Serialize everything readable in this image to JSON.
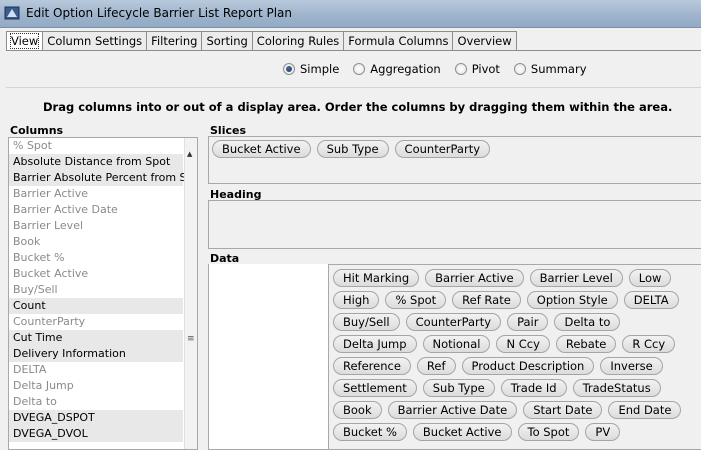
{
  "window": {
    "title": "Edit Option Lifecycle Barrier List Report Plan"
  },
  "tabs": [
    {
      "label": "View",
      "active": true
    },
    {
      "label": "Column Settings",
      "active": false
    },
    {
      "label": "Filtering",
      "active": false
    },
    {
      "label": "Sorting",
      "active": false
    },
    {
      "label": "Coloring Rules",
      "active": false
    },
    {
      "label": "Formula Columns",
      "active": false
    },
    {
      "label": "Overview",
      "active": false
    }
  ],
  "modes": [
    {
      "label": "Simple",
      "selected": true
    },
    {
      "label": "Aggregation",
      "selected": false
    },
    {
      "label": "Pivot",
      "selected": false
    },
    {
      "label": "Summary",
      "selected": false
    }
  ],
  "instructions": "Drag columns into or out of a display area. Order the columns by dragging them within the area.",
  "columns": {
    "header": "Columns",
    "items": [
      {
        "label": "% Spot",
        "style": "grey"
      },
      {
        "label": "Absolute Distance from Spot",
        "style": "shade"
      },
      {
        "label": "Barrier Absolute Percent from Spot",
        "style": "shade"
      },
      {
        "label": "Barrier Active",
        "style": "grey"
      },
      {
        "label": "Barrier Active Date",
        "style": "grey"
      },
      {
        "label": "Barrier Level",
        "style": "grey"
      },
      {
        "label": "Book",
        "style": "grey"
      },
      {
        "label": "Bucket %",
        "style": "grey"
      },
      {
        "label": "Bucket Active",
        "style": "grey"
      },
      {
        "label": "Buy/Sell",
        "style": "grey"
      },
      {
        "label": "Count",
        "style": "shade"
      },
      {
        "label": "CounterParty",
        "style": "grey"
      },
      {
        "label": "Cut Time",
        "style": "shade"
      },
      {
        "label": "Delivery Information",
        "style": "shade"
      },
      {
        "label": "DELTA",
        "style": "grey"
      },
      {
        "label": "Delta Jump",
        "style": "grey"
      },
      {
        "label": "Delta to",
        "style": "grey"
      },
      {
        "label": "DVEGA_DSPOT",
        "style": "shade"
      },
      {
        "label": "DVEGA_DVOL",
        "style": "shade"
      }
    ]
  },
  "slices": {
    "header": "Slices",
    "chips": [
      "Bucket Active",
      "Sub Type",
      "CounterParty"
    ]
  },
  "heading": {
    "header": "Heading",
    "chips": []
  },
  "data": {
    "header": "Data",
    "chips": [
      "Hit Marking",
      "Barrier Active",
      "Barrier Level",
      "Low",
      "High",
      "% Spot",
      "Ref Rate",
      "Option Style",
      "DELTA",
      "Buy/Sell",
      "CounterParty",
      "Pair",
      "Delta to",
      "Delta Jump",
      "Notional",
      "N Ccy",
      "Rebate",
      "R Ccy",
      "Reference",
      "Ref",
      "Product Description",
      "Inverse",
      "Settlement",
      "Sub Type",
      "Trade Id",
      "TradeStatus",
      "Book",
      "Barrier Active Date",
      "Start Date",
      "End Date",
      "Bucket %",
      "Bucket Active",
      "To Spot",
      "PV"
    ]
  },
  "icons": {
    "app": "window-app-icon",
    "scroll_up": "scroll-up-arrow-icon",
    "grip": "scroll-grip-icon"
  }
}
